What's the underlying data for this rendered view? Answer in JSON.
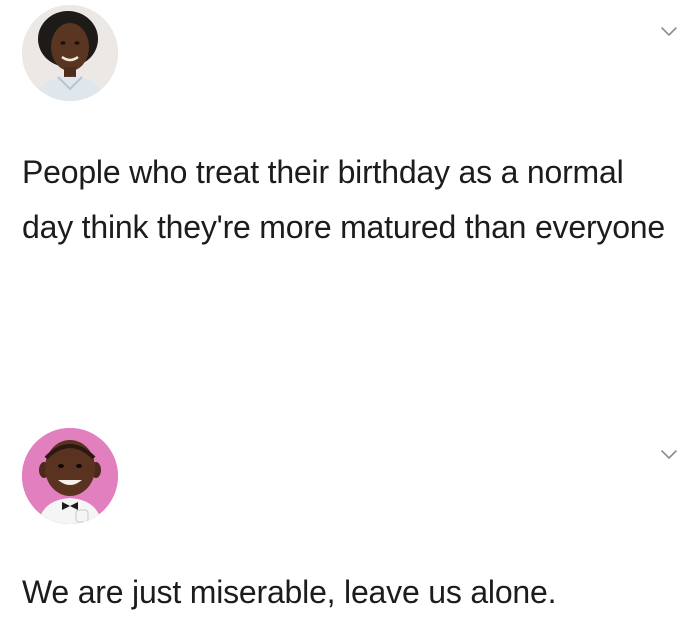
{
  "tweets": [
    {
      "text": "People who treat their birthday as a normal day think they're more matured than everyone",
      "avatar_icon": "profile-photo-woman",
      "menu_icon": "chevron-down-icon"
    },
    {
      "text": "We are just miserable, leave us alone.",
      "avatar_icon": "profile-avatar-bitmoji-man",
      "menu_icon": "chevron-down-icon"
    }
  ],
  "colors": {
    "background": "#ffffff",
    "text": "#1c1c1c",
    "caret": "#8a9096",
    "avatar2_bg": "#e27fbf"
  }
}
